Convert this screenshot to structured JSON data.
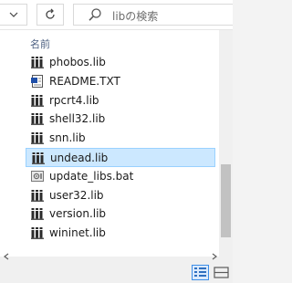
{
  "search": {
    "placeholder": "libの検索"
  },
  "column_header": "名前",
  "files": [
    {
      "name": "phobos.lib",
      "icon": "lib-file-icon",
      "selected": false
    },
    {
      "name": "README.TXT",
      "icon": "text-file-icon",
      "selected": false
    },
    {
      "name": "rpcrt4.lib",
      "icon": "lib-file-icon",
      "selected": false
    },
    {
      "name": "shell32.lib",
      "icon": "lib-file-icon",
      "selected": false
    },
    {
      "name": "snn.lib",
      "icon": "lib-file-icon",
      "selected": false
    },
    {
      "name": "undead.lib",
      "icon": "lib-file-icon",
      "selected": true
    },
    {
      "name": "update_libs.bat",
      "icon": "bat-file-icon",
      "selected": false
    },
    {
      "name": "user32.lib",
      "icon": "lib-file-icon",
      "selected": false
    },
    {
      "name": "version.lib",
      "icon": "lib-file-icon",
      "selected": false
    },
    {
      "name": "wininet.lib",
      "icon": "lib-file-icon",
      "selected": false
    }
  ],
  "colors": {
    "selection_bg": "#cce8ff",
    "selection_border": "#99d1ff",
    "header_text": "#4d6082"
  }
}
